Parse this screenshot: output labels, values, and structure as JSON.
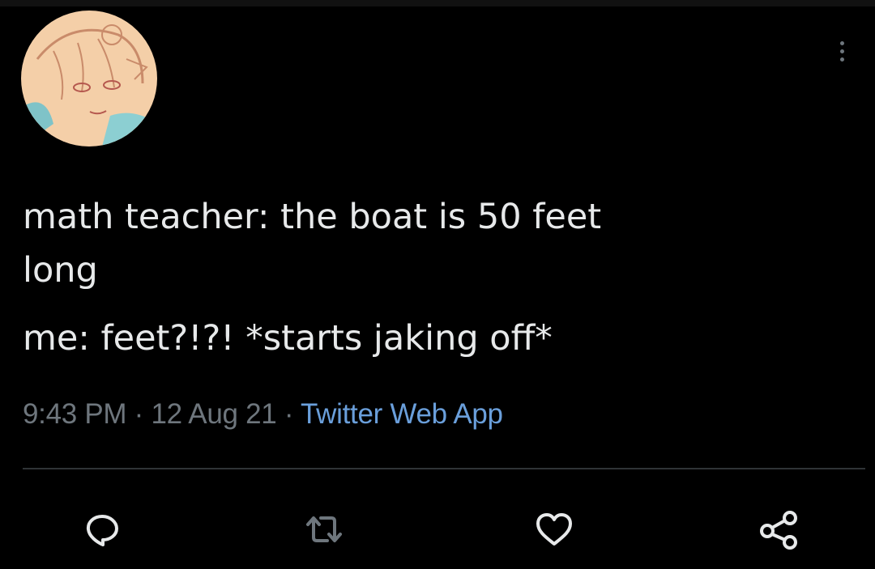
{
  "tweet": {
    "avatar_icon": "user-avatar",
    "text_lines": [
      "math teacher: the boat is 50 feet",
      "long",
      "me: feet?!?! *starts jaking off*"
    ],
    "time": "9:43 PM",
    "separator": " · ",
    "date": "12 Aug 21",
    "source": "Twitter Web App"
  },
  "actions": [
    {
      "icon": "reply-icon"
    },
    {
      "icon": "retweet-icon"
    },
    {
      "icon": "like-icon"
    },
    {
      "icon": "share-icon"
    }
  ],
  "colors": {
    "background": "#000000",
    "text": "#e7e9ea",
    "muted": "#6e767d",
    "link": "#6a9fdb",
    "divider": "#2f3336"
  }
}
